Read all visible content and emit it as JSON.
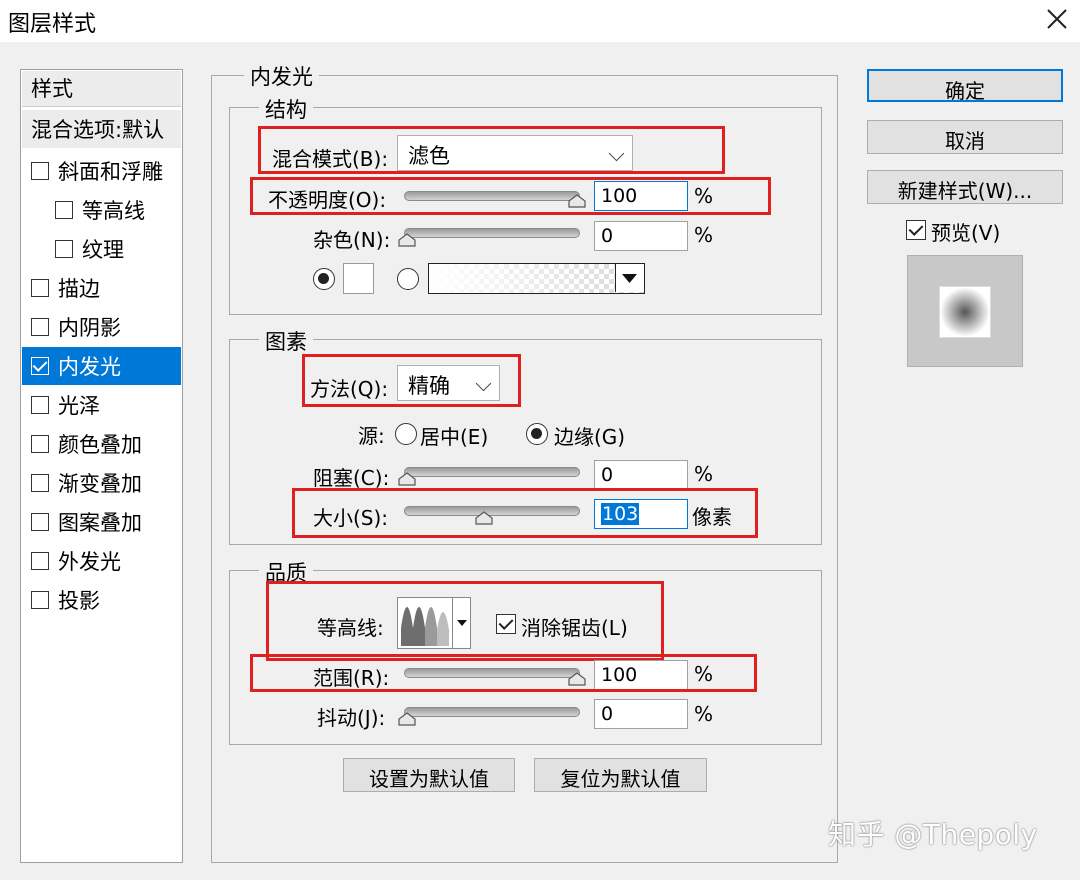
{
  "window": {
    "title": "图层样式"
  },
  "sidebar": {
    "header": "样式",
    "blending_options": "混合选项:默认",
    "items": [
      {
        "label": "斜面和浮雕",
        "checked": false,
        "indent": false
      },
      {
        "label": "等高线",
        "checked": false,
        "indent": true
      },
      {
        "label": "纹理",
        "checked": false,
        "indent": true
      },
      {
        "label": "描边",
        "checked": false,
        "indent": false
      },
      {
        "label": "内阴影",
        "checked": false,
        "indent": false
      },
      {
        "label": "内发光",
        "checked": true,
        "indent": false,
        "active": true
      },
      {
        "label": "光泽",
        "checked": false,
        "indent": false
      },
      {
        "label": "颜色叠加",
        "checked": false,
        "indent": false
      },
      {
        "label": "渐变叠加",
        "checked": false,
        "indent": false
      },
      {
        "label": "图案叠加",
        "checked": false,
        "indent": false
      },
      {
        "label": "外发光",
        "checked": false,
        "indent": false
      },
      {
        "label": "投影",
        "checked": false,
        "indent": false
      }
    ]
  },
  "panel": {
    "title": "内发光",
    "structure": {
      "title": "结构",
      "blend_mode_label": "混合模式(B):",
      "blend_mode_value": "滤色",
      "opacity_label": "不透明度(O):",
      "opacity_value": "100",
      "opacity_percent": 1.0,
      "noise_label": "杂色(N):",
      "noise_value": "0",
      "noise_percent": 0.0,
      "unit_percent": "%",
      "color_swatch": "#ffffff",
      "fill_mode": "color"
    },
    "elements": {
      "title": "图素",
      "technique_label": "方法(Q):",
      "technique_value": "精确",
      "source_label": "源:",
      "source_center": "居中(E)",
      "source_edge": "边缘(G)",
      "source_selected": "edge",
      "choke_label": "阻塞(C):",
      "choke_value": "0",
      "choke_percent": 0.0,
      "size_label": "大小(S):",
      "size_value": "103",
      "size_fraction": 0.45,
      "size_unit": "像素",
      "unit_percent": "%"
    },
    "quality": {
      "title": "品质",
      "contour_label": "等高线:",
      "anti_alias_label": "消除锯齿(L)",
      "anti_alias_checked": true,
      "range_label": "范围(R):",
      "range_value": "100",
      "range_percent": 1.0,
      "jitter_label": "抖动(J):",
      "jitter_value": "0",
      "jitter_percent": 0.0,
      "unit_percent": "%"
    },
    "buttons": {
      "make_default": "设置为默认值",
      "reset_default": "复位为默认值"
    }
  },
  "actions": {
    "ok": "确定",
    "cancel": "取消",
    "new_style": "新建样式(W)...",
    "preview_label": "预览(V)",
    "preview_checked": true
  },
  "watermark": "知乎 @Thepoly",
  "colors": {
    "accent": "#0078d7",
    "highlight_red": "#e02020"
  }
}
